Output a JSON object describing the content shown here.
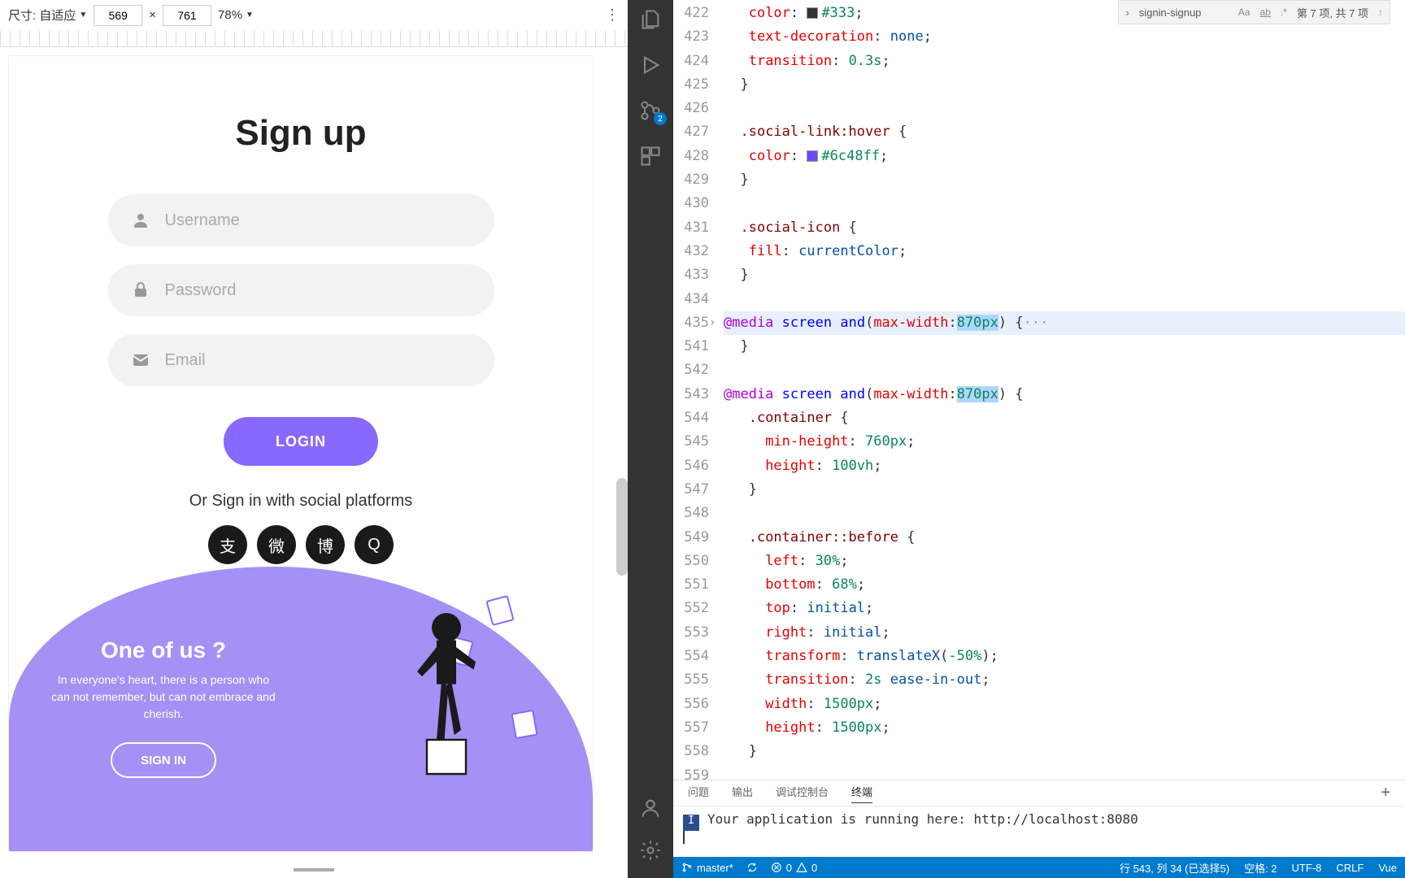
{
  "toolbar": {
    "size_label": "尺寸: 自适应",
    "width": "569",
    "height": "761",
    "times": "×",
    "zoom": "78%"
  },
  "signup": {
    "heading": "Sign up",
    "username_ph": "Username",
    "password_ph": "Password",
    "email_ph": "Email",
    "login_btn": "LOGIN",
    "social_text": "Or Sign in with social platforms",
    "social": [
      "支",
      "微",
      "博",
      "Q"
    ],
    "wave_title": "One of us ?",
    "wave_text": "In everyone's heart, there is a person who can not remember, but can not embrace and cherish.",
    "signin_btn": "SIGN IN"
  },
  "activity": {
    "scm_badge": "2"
  },
  "search": {
    "text": "signin-signup",
    "results": "第 7 项, 共 7 项"
  },
  "code": {
    "lines": [
      {
        "n": 422,
        "seg": [
          {
            "c": "k-prop",
            "t": "color"
          },
          {
            "c": "k-punc",
            "t": ": "
          },
          {
            "sw": "#333"
          },
          {
            "c": "k-num",
            "t": "#333"
          },
          {
            "c": "k-punc",
            "t": ";"
          }
        ],
        "ind": 2
      },
      {
        "n": 423,
        "seg": [
          {
            "c": "k-prop",
            "t": "text-decoration"
          },
          {
            "c": "k-punc",
            "t": ": "
          },
          {
            "c": "k-val",
            "t": "none"
          },
          {
            "c": "k-punc",
            "t": ";"
          }
        ],
        "ind": 2
      },
      {
        "n": 424,
        "seg": [
          {
            "c": "k-prop",
            "t": "transition"
          },
          {
            "c": "k-punc",
            "t": ": "
          },
          {
            "c": "k-num",
            "t": "0.3s"
          },
          {
            "c": "k-punc",
            "t": ";"
          }
        ],
        "ind": 2
      },
      {
        "n": 425,
        "seg": [
          {
            "c": "k-punc",
            "t": "}"
          }
        ],
        "ind": 1
      },
      {
        "n": 426,
        "seg": [],
        "ind": 0
      },
      {
        "n": 427,
        "seg": [
          {
            "c": "k-sel",
            "t": ".social-link:hover"
          },
          {
            "c": "k-punc",
            "t": " {"
          }
        ],
        "ind": 1
      },
      {
        "n": 428,
        "seg": [
          {
            "c": "k-prop",
            "t": "color"
          },
          {
            "c": "k-punc",
            "t": ": "
          },
          {
            "sw": "#6c48ff"
          },
          {
            "c": "k-num",
            "t": "#6c48ff"
          },
          {
            "c": "k-punc",
            "t": ";"
          }
        ],
        "ind": 2
      },
      {
        "n": 429,
        "seg": [
          {
            "c": "k-punc",
            "t": "}"
          }
        ],
        "ind": 1
      },
      {
        "n": 430,
        "seg": [],
        "ind": 0
      },
      {
        "n": 431,
        "seg": [
          {
            "c": "k-sel",
            "t": ".social-icon"
          },
          {
            "c": "k-punc",
            "t": " {"
          }
        ],
        "ind": 1
      },
      {
        "n": 432,
        "seg": [
          {
            "c": "k-prop",
            "t": "fill"
          },
          {
            "c": "k-punc",
            "t": ": "
          },
          {
            "c": "k-val",
            "t": "currentColor"
          },
          {
            "c": "k-punc",
            "t": ";"
          }
        ],
        "ind": 2
      },
      {
        "n": 433,
        "seg": [
          {
            "c": "k-punc",
            "t": "}"
          }
        ],
        "ind": 1
      },
      {
        "n": 434,
        "seg": [],
        "ind": 0
      },
      {
        "n": 435,
        "hl": true,
        "fold": true,
        "seg": [
          {
            "c": "k-at",
            "t": "@media"
          },
          {
            "c": "k-punc",
            "t": " "
          },
          {
            "c": "k-media",
            "t": "screen"
          },
          {
            "c": "k-punc",
            "t": " "
          },
          {
            "c": "k-media",
            "t": "and"
          },
          {
            "c": "k-punc",
            "t": "("
          },
          {
            "c": "k-prop",
            "t": "max-width"
          },
          {
            "c": "k-punc",
            "t": ":"
          },
          {
            "c": "k-num sel-hl",
            "t": "870px"
          },
          {
            "c": "k-punc",
            "t": ") {"
          },
          {
            "c": "fold-ellipsis",
            "t": "···"
          }
        ],
        "ind": 0
      },
      {
        "n": 541,
        "seg": [
          {
            "c": "k-punc",
            "t": "}"
          }
        ],
        "ind": 1
      },
      {
        "n": 542,
        "seg": [],
        "ind": 0
      },
      {
        "n": 543,
        "seg": [
          {
            "c": "k-at",
            "t": "@media"
          },
          {
            "c": "k-punc",
            "t": " "
          },
          {
            "c": "k-media",
            "t": "screen"
          },
          {
            "c": "k-punc",
            "t": " "
          },
          {
            "c": "k-media",
            "t": "and"
          },
          {
            "c": "k-punc",
            "t": "("
          },
          {
            "c": "k-prop",
            "t": "max-width"
          },
          {
            "c": "k-punc",
            "t": ":"
          },
          {
            "c": "k-num sel-hl",
            "t": "870px"
          },
          {
            "c": "k-punc",
            "t": ") {"
          }
        ],
        "ind": 0
      },
      {
        "n": 544,
        "seg": [
          {
            "c": "k-sel",
            "t": ".container"
          },
          {
            "c": "k-punc",
            "t": " {"
          }
        ],
        "ind": 2
      },
      {
        "n": 545,
        "seg": [
          {
            "c": "k-prop",
            "t": "min-height"
          },
          {
            "c": "k-punc",
            "t": ": "
          },
          {
            "c": "k-num",
            "t": "760px"
          },
          {
            "c": "k-punc",
            "t": ";"
          }
        ],
        "ind": 4
      },
      {
        "n": 546,
        "seg": [
          {
            "c": "k-prop",
            "t": "height"
          },
          {
            "c": "k-punc",
            "t": ": "
          },
          {
            "c": "k-num",
            "t": "100vh"
          },
          {
            "c": "k-punc",
            "t": ";"
          }
        ],
        "ind": 4
      },
      {
        "n": 547,
        "seg": [
          {
            "c": "k-punc",
            "t": "}"
          }
        ],
        "ind": 2
      },
      {
        "n": 548,
        "seg": [],
        "ind": 0
      },
      {
        "n": 549,
        "seg": [
          {
            "c": "k-sel",
            "t": ".container::before"
          },
          {
            "c": "k-punc",
            "t": " {"
          }
        ],
        "ind": 2
      },
      {
        "n": 550,
        "seg": [
          {
            "c": "k-prop",
            "t": "left"
          },
          {
            "c": "k-punc",
            "t": ": "
          },
          {
            "c": "k-num",
            "t": "30%"
          },
          {
            "c": "k-punc",
            "t": ";"
          }
        ],
        "ind": 4
      },
      {
        "n": 551,
        "seg": [
          {
            "c": "k-prop",
            "t": "bottom"
          },
          {
            "c": "k-punc",
            "t": ": "
          },
          {
            "c": "k-num",
            "t": "68%"
          },
          {
            "c": "k-punc",
            "t": ";"
          }
        ],
        "ind": 4
      },
      {
        "n": 552,
        "seg": [
          {
            "c": "k-prop",
            "t": "top"
          },
          {
            "c": "k-punc",
            "t": ": "
          },
          {
            "c": "k-val",
            "t": "initial"
          },
          {
            "c": "k-punc",
            "t": ";"
          }
        ],
        "ind": 4
      },
      {
        "n": 553,
        "seg": [
          {
            "c": "k-prop",
            "t": "right"
          },
          {
            "c": "k-punc",
            "t": ": "
          },
          {
            "c": "k-val",
            "t": "initial"
          },
          {
            "c": "k-punc",
            "t": ";"
          }
        ],
        "ind": 4
      },
      {
        "n": 554,
        "seg": [
          {
            "c": "k-prop",
            "t": "transform"
          },
          {
            "c": "k-punc",
            "t": ": "
          },
          {
            "c": "k-val",
            "t": "translateX"
          },
          {
            "c": "k-punc",
            "t": "("
          },
          {
            "c": "k-num",
            "t": "-50%"
          },
          {
            "c": "k-punc",
            "t": ");"
          }
        ],
        "ind": 4
      },
      {
        "n": 555,
        "seg": [
          {
            "c": "k-prop",
            "t": "transition"
          },
          {
            "c": "k-punc",
            "t": ": "
          },
          {
            "c": "k-num",
            "t": "2s"
          },
          {
            "c": "k-punc",
            "t": " "
          },
          {
            "c": "k-val",
            "t": "ease-in-out"
          },
          {
            "c": "k-punc",
            "t": ";"
          }
        ],
        "ind": 4
      },
      {
        "n": 556,
        "seg": [
          {
            "c": "k-prop",
            "t": "width"
          },
          {
            "c": "k-punc",
            "t": ": "
          },
          {
            "c": "k-num",
            "t": "1500px"
          },
          {
            "c": "k-punc",
            "t": ";"
          }
        ],
        "ind": 4
      },
      {
        "n": 557,
        "seg": [
          {
            "c": "k-prop",
            "t": "height"
          },
          {
            "c": "k-punc",
            "t": ": "
          },
          {
            "c": "k-num",
            "t": "1500px"
          },
          {
            "c": "k-punc",
            "t": ";"
          }
        ],
        "ind": 4
      },
      {
        "n": 558,
        "seg": [
          {
            "c": "k-punc",
            "t": "}"
          }
        ],
        "ind": 2
      },
      {
        "n": 559,
        "seg": [],
        "ind": 0
      }
    ]
  },
  "terminal": {
    "tabs": [
      "问题",
      "输出",
      "调试控制台",
      "终端"
    ],
    "active_tab": 3,
    "badge": "I",
    "text": "Your application is running here: http://localhost:8080"
  },
  "status": {
    "branch": "master*",
    "errors": "0",
    "warnings": "0",
    "cursor": "行 543, 列 34 (已选择5)",
    "spaces": "空格: 2",
    "encoding": "UTF-8",
    "eol": "CRLF",
    "lang": "Vue"
  }
}
